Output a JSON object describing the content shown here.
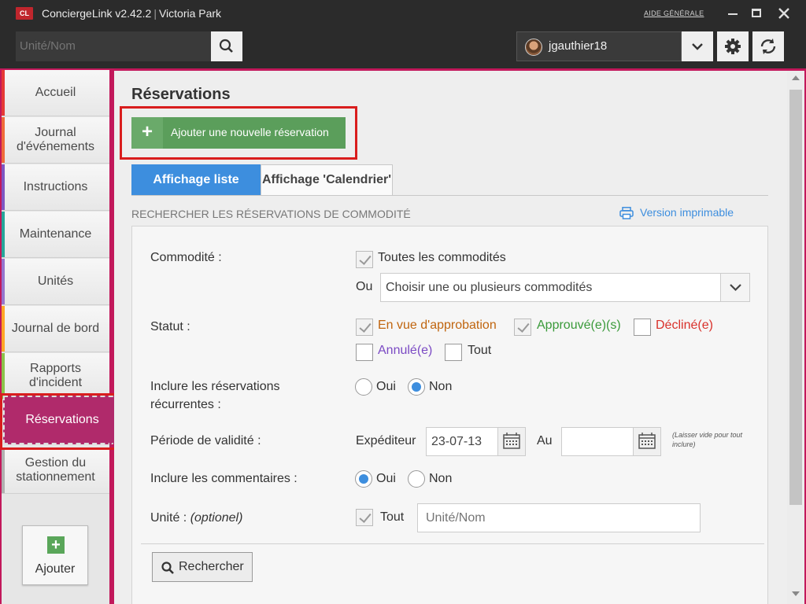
{
  "app": {
    "logo_text": "CL",
    "name": "ConciergeLink v2.42.2",
    "separator": "|",
    "location": "Victoria Park",
    "help_link": "AIDE GÉNÉRALE"
  },
  "header": {
    "search_placeholder": "Unité/Nom",
    "username": "jgauthier18"
  },
  "sidebar": {
    "items": [
      {
        "label": "Accueil",
        "color": "#e53935"
      },
      {
        "label": "Journal d'événements",
        "color": "#ef6c3a"
      },
      {
        "label": "Instructions",
        "color": "#7e57c2"
      },
      {
        "label": "Maintenance",
        "color": "#26a69a"
      },
      {
        "label": "Unités",
        "color": "#9575cd"
      },
      {
        "label": "Journal de bord",
        "color": "#ffa726"
      },
      {
        "label": "Rapports d'incident",
        "color": "#8bc34a"
      },
      {
        "label": "Réservations",
        "color": "#c2185b",
        "active": true
      },
      {
        "label": "Gestion du stationnement",
        "color": "#b0b0b0"
      }
    ],
    "add_label": "Ajouter",
    "add_symbol": "+"
  },
  "main": {
    "title": "Réservations",
    "add_button": {
      "symbol": "+",
      "label": "Ajouter une nouvelle réservation"
    },
    "tabs": [
      {
        "label": "Affichage liste",
        "active": true
      },
      {
        "label": "Affichage 'Calendrier'",
        "active": false
      }
    ],
    "section_title": "RECHERCHER LES RÉSERVATIONS DE COMMODITÉ",
    "print_link": "Version imprimable",
    "form": {
      "commodite_label": "Commodité :",
      "all_commodities": "Toutes les commodités",
      "or_label": "Ou",
      "commodity_select_placeholder": "Choisir une ou plusieurs commodités",
      "statut_label": "Statut :",
      "statuses": [
        {
          "label": "En vue d'approbation",
          "checked": true,
          "color": "#c0650f"
        },
        {
          "label": "Approuvé(e)(s)",
          "checked": true,
          "color": "#3a9a3a"
        },
        {
          "label": "Décliné(e)",
          "checked": false,
          "color": "#d9312b"
        },
        {
          "label": "Annulé(e)",
          "checked": false,
          "color": "#7b4ac4"
        },
        {
          "label": "Tout",
          "checked": false,
          "color": "#333333"
        }
      ],
      "recurring_label_line1": "Inclure les réservations",
      "recurring_label_line2": "récurrentes :",
      "recurring_yes": "Oui",
      "recurring_no": "Non",
      "recurring_value": "Non",
      "period_label": "Période de validité :",
      "from_label": "Expéditeur",
      "from_value": "23-07-13",
      "to_label": "Au",
      "to_value": "",
      "period_hint_line1": "(Laisser vide pour tout",
      "period_hint_line2": "inclure)",
      "comments_label": "Inclure les commentaires :",
      "comments_yes": "Oui",
      "comments_no": "Non",
      "comments_value": "Oui",
      "unit_label": "Unité :",
      "unit_label_optional": "(optionel)",
      "unit_all": "Tout",
      "unit_placeholder": "Unité/Nom",
      "search_button": "Rechercher"
    }
  }
}
